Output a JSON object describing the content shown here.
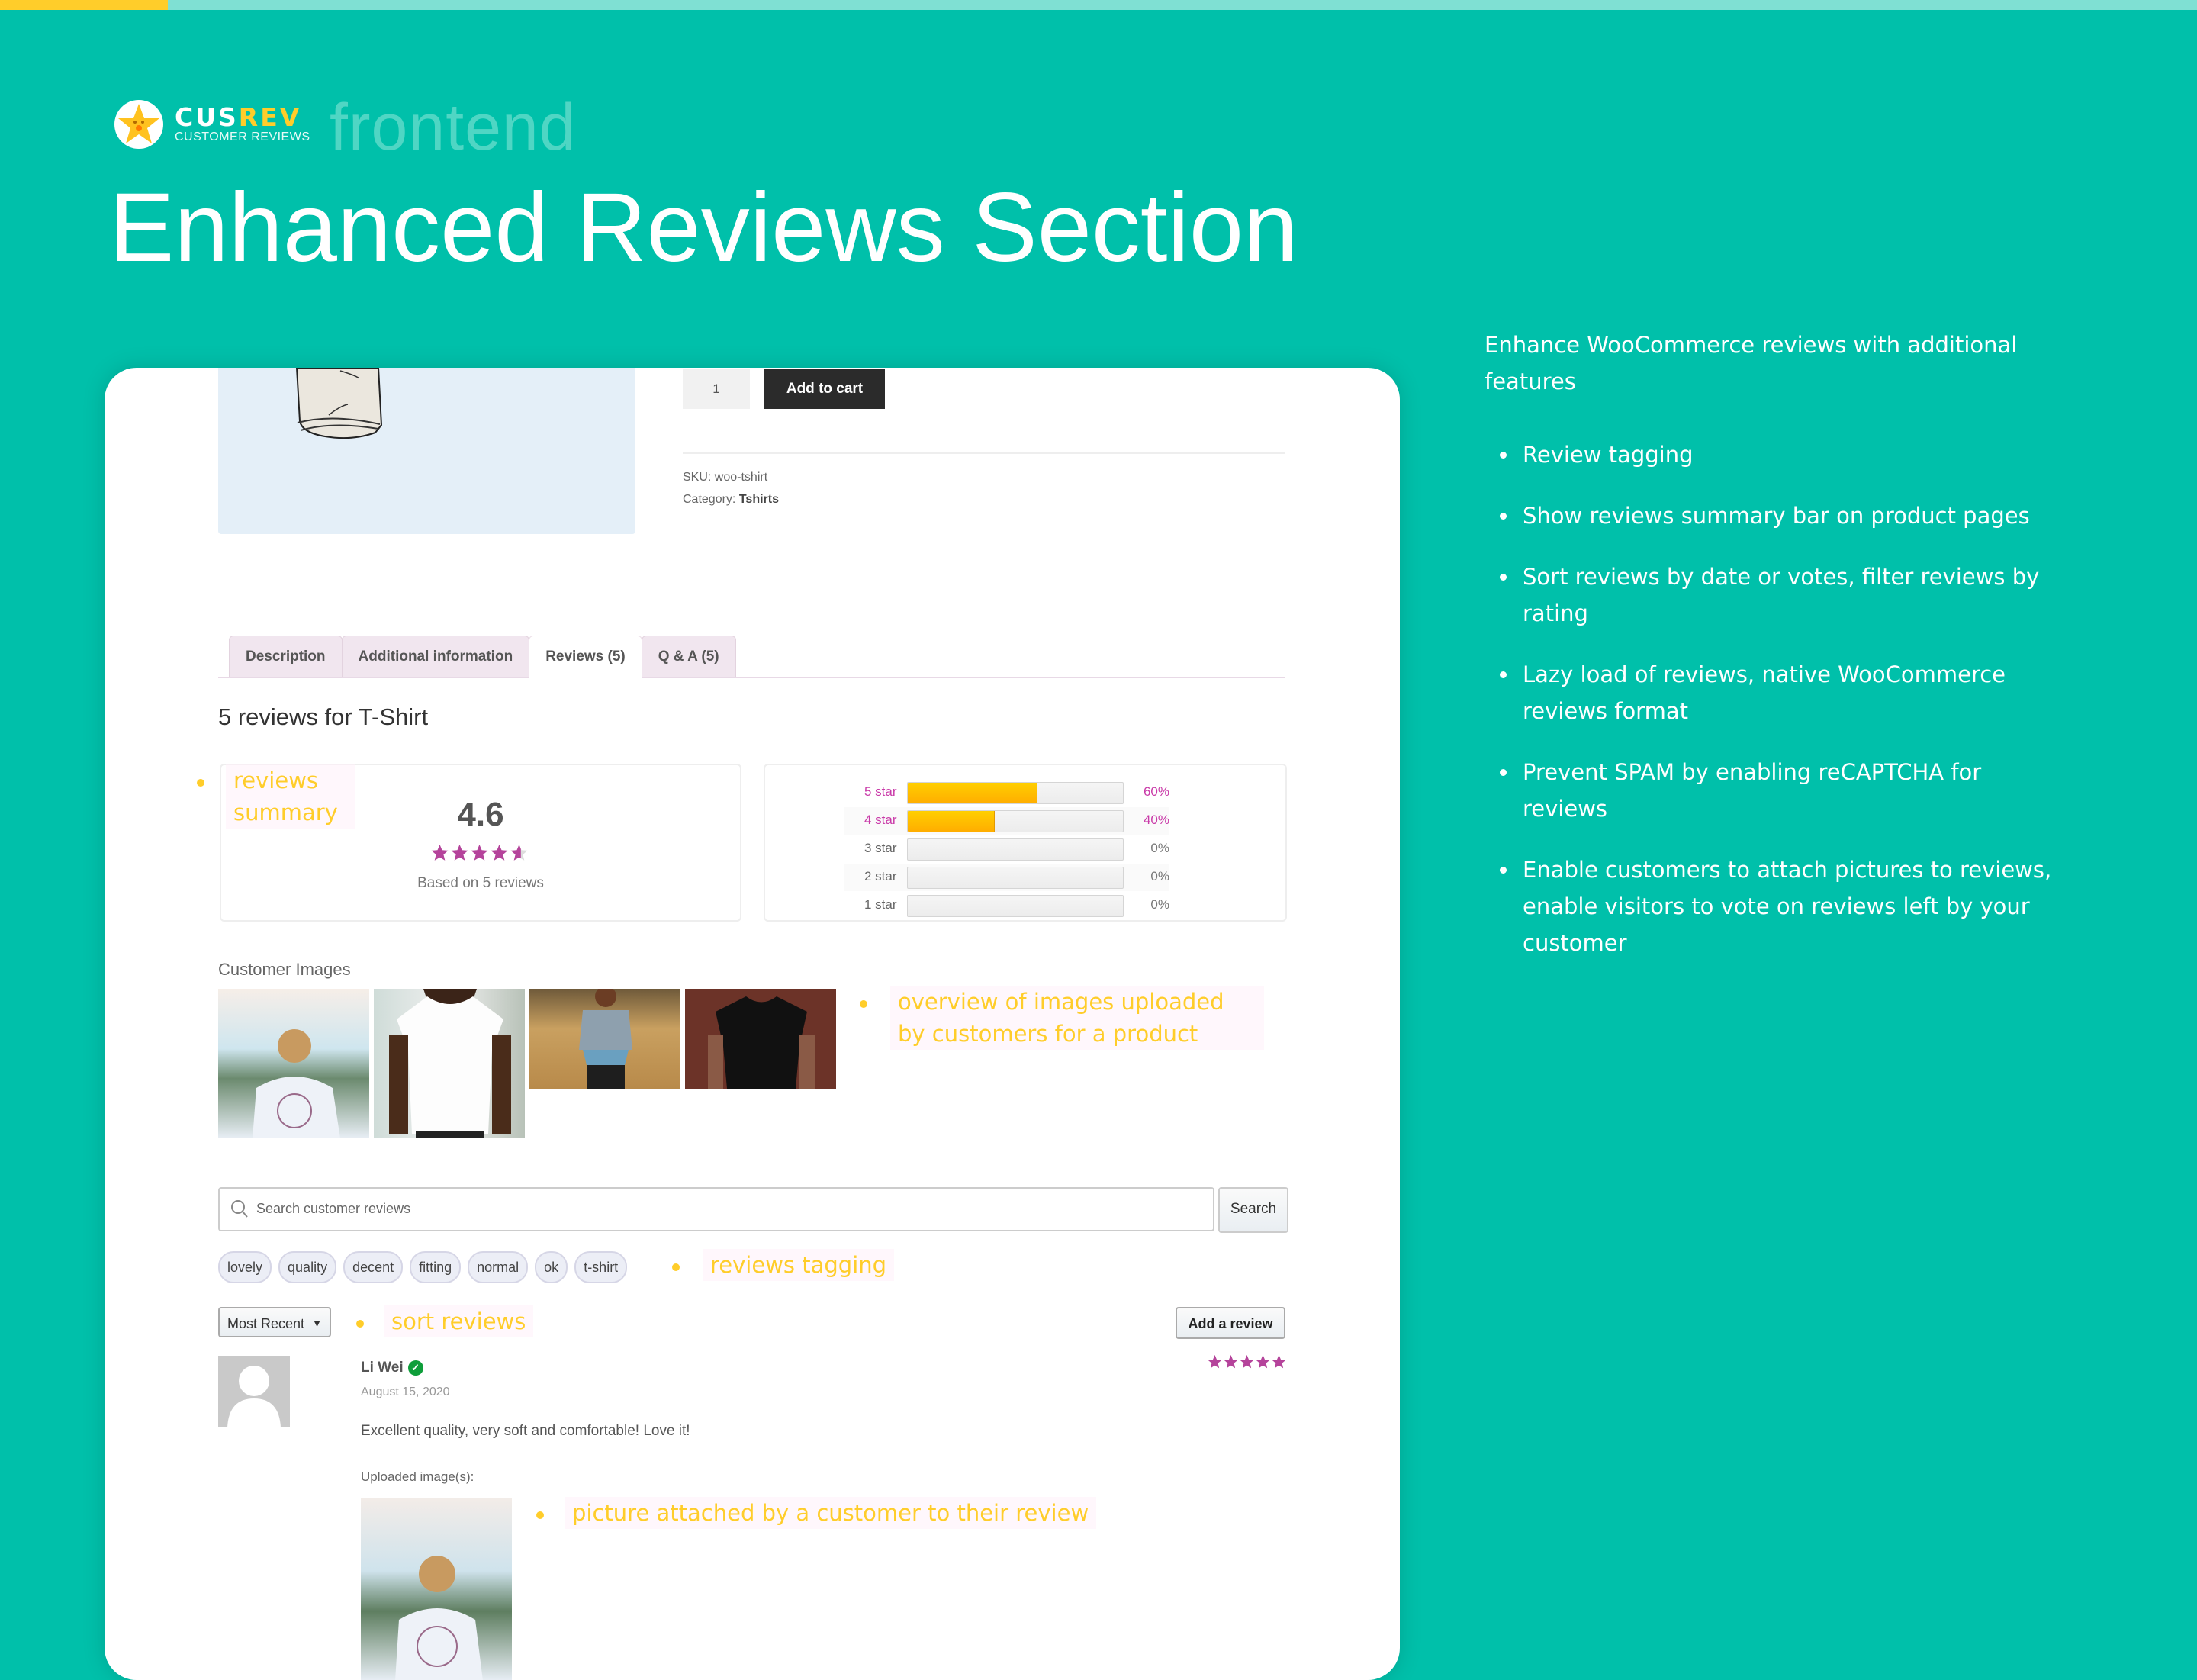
{
  "brand": {
    "logo_word_1": "CUS",
    "logo_word_2": "REV",
    "logo_subtitle": "CUSTOMER REVIEWS",
    "section_tag": "frontend"
  },
  "headline": "Enhanced Reviews Section",
  "sidebar": {
    "intro": "Enhance WooCommerce reviews with additional features",
    "features": [
      "Review tagging",
      "Show reviews summary bar on product pages",
      "Sort reviews by date or votes, filter reviews by rating",
      "Lazy load of reviews, native WooCommerce reviews format",
      "Prevent SPAM by enabling reCAPTCHA for reviews",
      "Enable customers to attach pictures to reviews, enable visitors to vote on reviews left by your customer"
    ]
  },
  "product": {
    "quantity": "1",
    "add_to_cart_label": "Add to cart",
    "sku_label": "SKU:",
    "sku_value": "woo-tshirt",
    "category_label": "Category:",
    "category_value": "Tshirts"
  },
  "tabs": [
    {
      "label": "Description",
      "active": false
    },
    {
      "label": "Additional information",
      "active": false
    },
    {
      "label": "Reviews (5)",
      "active": true
    },
    {
      "label": "Q & A (5)",
      "active": false
    }
  ],
  "reviews": {
    "heading": "5 reviews for T-Shirt",
    "summary": {
      "average": "4.6",
      "average_rating": 4.6,
      "based_on": "Based on 5 reviews"
    },
    "histogram": [
      {
        "label": "5 star",
        "percent": 60,
        "percent_label": "60%",
        "highlight": true
      },
      {
        "label": "4 star",
        "percent": 40,
        "percent_label": "40%",
        "highlight": true
      },
      {
        "label": "3 star",
        "percent": 0,
        "percent_label": "0%",
        "highlight": false
      },
      {
        "label": "2 star",
        "percent": 0,
        "percent_label": "0%",
        "highlight": false
      },
      {
        "label": "1 star",
        "percent": 0,
        "percent_label": "0%",
        "highlight": false
      }
    ],
    "customer_images_label": "Customer Images",
    "customer_images": [
      {
        "alt": "man in cap wearing white printed t-shirt, back view"
      },
      {
        "alt": "man wearing plain white t-shirt"
      },
      {
        "alt": "woman in grey t-shirt in wheat field"
      },
      {
        "alt": "person wearing black t-shirt"
      }
    ],
    "search_placeholder": "Search customer reviews",
    "search_button": "Search",
    "tags": [
      "lovely",
      "quality",
      "decent",
      "fitting",
      "normal",
      "ok",
      "t-shirt"
    ],
    "sort_selected": "Most Recent",
    "add_review_label": "Add a review",
    "list": [
      {
        "author": "Li Wei",
        "verified": true,
        "date": "August 15, 2020",
        "rating": 5,
        "text": "Excellent quality, very soft and comfortable! Love it!",
        "uploaded_label": "Uploaded image(s):"
      }
    ]
  },
  "annotations": {
    "summary": "reviews summary",
    "images": "overview of images uploaded by customers for a product",
    "tagging": "reviews tagging",
    "sort": "sort reviews",
    "picture": "picture attached by a customer to their review"
  },
  "colors": {
    "background": "#00c0aa",
    "accent_yellow": "#ffcd2a",
    "star_purple": "#b5439b",
    "bar_orange": "#ffb400"
  }
}
